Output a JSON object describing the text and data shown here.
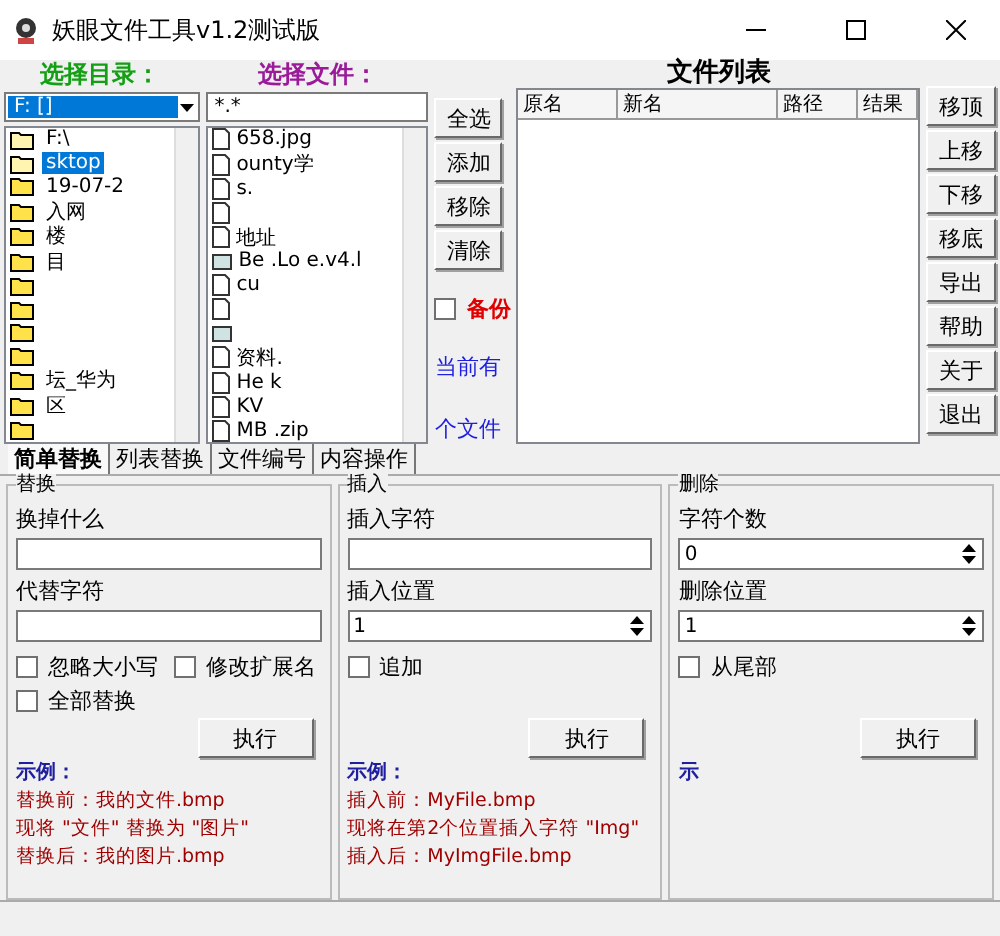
{
  "window": {
    "title": "妖眼文件工具v1.2测试版"
  },
  "directory": {
    "label": "选择目录：",
    "drive": "F: []",
    "folders": [
      {
        "name": "F:\\",
        "kind": "open",
        "selected": false
      },
      {
        "name": "sktop",
        "kind": "open",
        "selected": true
      },
      {
        "name": "19-07-2",
        "kind": "closed",
        "selected": false
      },
      {
        "name": "入网",
        "kind": "closed",
        "selected": false
      },
      {
        "name": "楼",
        "kind": "closed",
        "selected": false
      },
      {
        "name": "目",
        "kind": "closed",
        "selected": false
      },
      {
        "kind": "closed",
        "selected": false
      },
      {
        "kind": "closed",
        "selected": false
      },
      {
        "kind": "closed",
        "selected": false
      },
      {
        "kind": "closed",
        "selected": false
      },
      {
        "name": "坛_华为",
        "kind": "closed",
        "selected": false
      },
      {
        "name": "区",
        "kind": "closed",
        "selected": false
      },
      {
        "kind": "closed",
        "selected": false
      }
    ]
  },
  "files": {
    "label": "选择文件：",
    "filter": "*.*",
    "items": [
      {
        "name": "658.jpg",
        "kind": "doc"
      },
      {
        "name": "ounty学",
        "kind": "doc"
      },
      {
        "name": "s.",
        "kind": "doc"
      },
      {
        "kind": "doc"
      },
      {
        "name": "地址",
        "kind": "doc"
      },
      {
        "name": "Be    .Lo    e.v4.l",
        "kind": "app"
      },
      {
        "name": "cu",
        "kind": "doc"
      },
      {
        "kind": "doc"
      },
      {
        "kind": "app"
      },
      {
        "name": "资料.",
        "kind": "doc"
      },
      {
        "name": "He     k",
        "kind": "doc"
      },
      {
        "name": "KV",
        "kind": "doc"
      },
      {
        "name": "MB         .zip",
        "kind": "doc"
      }
    ]
  },
  "file_buttons": [
    "全选",
    "添加",
    "移除",
    "清除"
  ],
  "backup": {
    "label": "备份",
    "checked": false
  },
  "count_lines": [
    "当前有",
    "个文件"
  ],
  "file_list": {
    "title": "文件列表",
    "columns": [
      "原名",
      "新名",
      "路径",
      "结果"
    ]
  },
  "side_buttons": [
    "移顶",
    "上移",
    "下移",
    "移底",
    "导出",
    "帮助",
    "关于",
    "退出"
  ],
  "tabs": [
    {
      "label": "简单替换",
      "selected": true
    },
    {
      "label": "列表替换",
      "selected": false
    },
    {
      "label": "文件编号",
      "selected": false
    },
    {
      "label": "内容操作",
      "selected": false
    }
  ],
  "groups": [
    {
      "title": "替换",
      "fields": [
        {
          "label": "换掉什么",
          "kind": "text"
        },
        {
          "label": "代替字符",
          "kind": "text"
        }
      ],
      "options": [
        {
          "label": "忽略大小写",
          "checked": false
        },
        {
          "label": "修改扩展名",
          "checked": false
        },
        {
          "label": "全部替换",
          "checked": false
        }
      ],
      "button": "执行",
      "example": {
        "title": "示例：",
        "lines": [
          "替换前：我的文件.bmp",
          "现将 \"文件\" 替换为 \"图片\"",
          "替换后：我的图片.bmp"
        ]
      }
    },
    {
      "title": "插入",
      "fields": [
        {
          "label": "插入字符",
          "kind": "text"
        },
        {
          "label": "插入位置",
          "kind": "spin",
          "value": "1"
        }
      ],
      "options": [
        {
          "label": "追加",
          "checked": false
        }
      ],
      "button": "执行",
      "example": {
        "title": "示例：",
        "lines": [
          "插入前：MyFile.bmp",
          "现将在第2个位置插入字符 \"Img\"",
          "插入后：MyImgFile.bmp"
        ]
      }
    },
    {
      "title": "删除",
      "fields": [
        {
          "label": "字符个数",
          "kind": "spin",
          "value": "0"
        },
        {
          "label": "删除位置",
          "kind": "spin",
          "value": "1"
        }
      ],
      "options": [
        {
          "label": "从尾部",
          "checked": false
        }
      ],
      "button": "执行",
      "example": {
        "title": "示"
      }
    }
  ]
}
